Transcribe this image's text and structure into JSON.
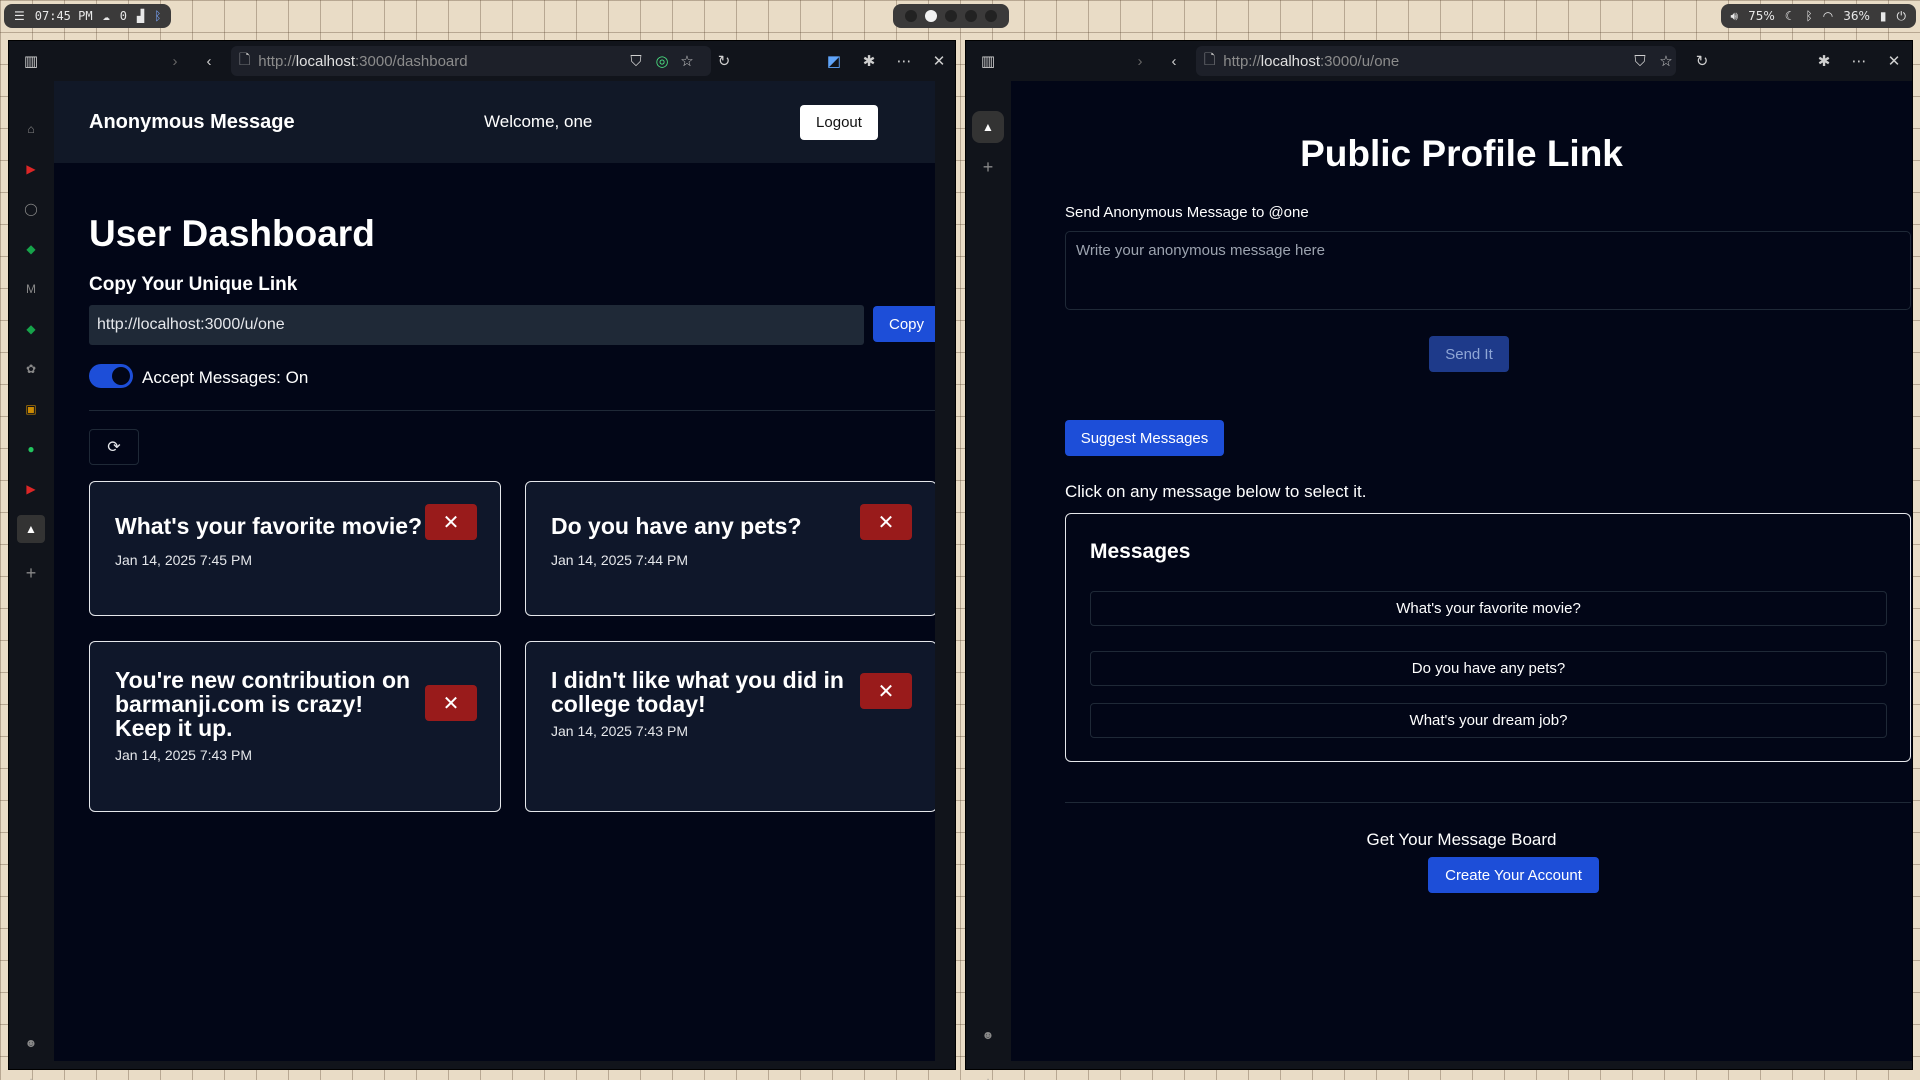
{
  "system_bar": {
    "time": "07:45 PM",
    "cloud_count": "0",
    "volume": "75%",
    "battery": "36%"
  },
  "left_browser": {
    "url_prefix": "http://",
    "url_host": "localhost",
    "url_path": ":3000/dashboard",
    "page": {
      "brand": "Anonymous Message",
      "welcome": "Welcome, one",
      "logout_label": "Logout",
      "title": "User Dashboard",
      "copy_title": "Copy Your Unique Link",
      "unique_link": "http://localhost:3000/u/one",
      "copy_label": "Copy",
      "accept_label": "Accept Messages: On",
      "accept_on": true,
      "cards": [
        {
          "text": "What's your favorite movie?",
          "date": "Jan 14, 2025 7:45 PM"
        },
        {
          "text": "Do you have any pets?",
          "date": "Jan 14, 2025 7:44 PM"
        },
        {
          "text": "You're new contribution on barmanji.com is crazy! Keep it up.",
          "date": "Jan 14, 2025 7:43 PM"
        },
        {
          "text": "I didn't like what you did in college today!",
          "date": "Jan 14, 2025 7:43 PM"
        }
      ]
    }
  },
  "right_browser": {
    "url_prefix": "http://",
    "url_host": "localhost",
    "url_path": ":3000/u/one",
    "page": {
      "title": "Public Profile Link",
      "send_label": "Send Anonymous Message to @one",
      "message_placeholder": "Write your anonymous message here",
      "send_label_btn": "Send It",
      "suggest_label": "Suggest Messages",
      "click_hint": "Click on any message below to select it.",
      "messages_title": "Messages",
      "messages": [
        "What's your favorite movie?",
        "Do you have any pets?",
        "What's your dream job?"
      ],
      "board_label": "Get Your Message Board",
      "create_label": "Create Your Account"
    }
  },
  "colors": {
    "accent_blue": "#1d4ed8",
    "delete_red": "#991b1b",
    "page_bg": "#020617",
    "card_bg": "#0f172a"
  }
}
